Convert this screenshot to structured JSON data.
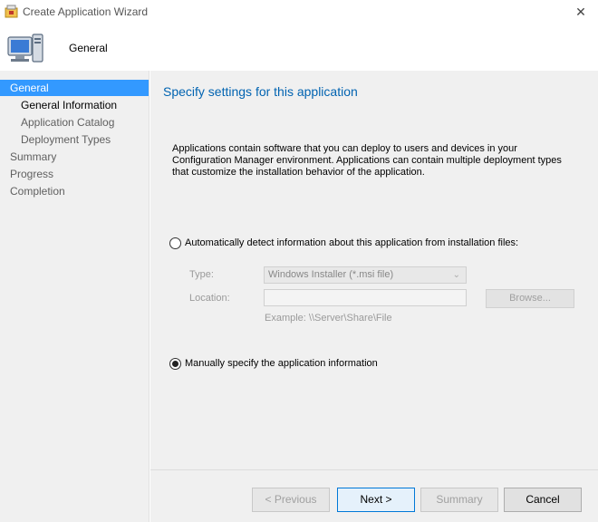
{
  "window": {
    "title": "Create Application Wizard",
    "close_glyph": "✕"
  },
  "header": {
    "title": "General"
  },
  "nav": {
    "items": [
      {
        "label": "General",
        "level": "top",
        "state": "active"
      },
      {
        "label": "General Information",
        "level": "sub",
        "state": "current"
      },
      {
        "label": "Application Catalog",
        "level": "sub",
        "state": "normal"
      },
      {
        "label": "Deployment Types",
        "level": "sub",
        "state": "normal"
      },
      {
        "label": "Summary",
        "level": "top",
        "state": "normal"
      },
      {
        "label": "Progress",
        "level": "top",
        "state": "normal"
      },
      {
        "label": "Completion",
        "level": "top",
        "state": "normal"
      }
    ]
  },
  "content": {
    "title": "Specify settings for this application",
    "description": "Applications contain software that you can deploy to users and devices in your Configuration Manager environment. Applications can contain multiple deployment types that customize the installation behavior of the application.",
    "option_auto": {
      "label": "Automatically detect information about this application from installation files:",
      "selected": false
    },
    "type_label": "Type:",
    "type_value": "Windows Installer (*.msi file)",
    "location_label": "Location:",
    "location_value": "",
    "browse_label": "Browse...",
    "example_text": "Example: \\\\Server\\Share\\File",
    "option_manual": {
      "label": "Manually specify the application information",
      "selected": true
    }
  },
  "footer": {
    "previous_label": "< Previous",
    "next_label": "Next >",
    "summary_label": "Summary",
    "cancel_label": "Cancel"
  },
  "colors": {
    "accent": "#3399ff",
    "title_blue": "#0063b1",
    "pane_bg": "#f0f0f0"
  }
}
